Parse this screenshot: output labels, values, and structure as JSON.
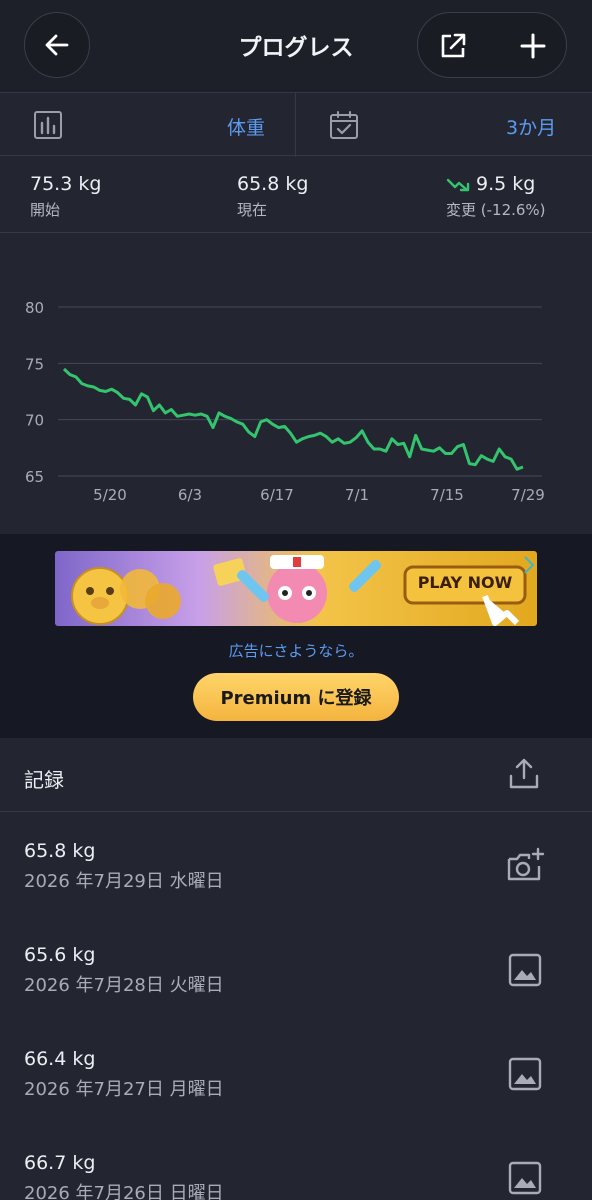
{
  "header": {
    "title": "プログレス",
    "back_icon": "arrow-left-icon",
    "share_icon": "external-link-icon",
    "add_icon": "plus-icon"
  },
  "selector": {
    "metric_icon": "bar-chart-icon",
    "metric_value": "体重",
    "range_icon": "calendar-check-icon",
    "range_value": "3か月"
  },
  "stats": {
    "start": {
      "value": "75.3 kg",
      "label": "開始"
    },
    "current": {
      "value": "65.8 kg",
      "label": "現在"
    },
    "change": {
      "value": "9.5 kg",
      "label": "変更 (-12.6%)",
      "trend_icon": "trend-down-icon",
      "trend_color": "#35c46e"
    }
  },
  "chart_data": {
    "type": "line",
    "x_tick_labels": [
      "5/20",
      "6/3",
      "6/17",
      "7/1",
      "7/15",
      "7/29"
    ],
    "y_ticks": [
      80,
      75,
      70,
      65
    ],
    "ylim": [
      65,
      80
    ],
    "grid": true,
    "line_color": "#35c46e",
    "series": [
      {
        "values": [
          74.5,
          74.0,
          73.8,
          73.2,
          73.0,
          72.9,
          72.6,
          72.5,
          72.7,
          72.4,
          71.9,
          71.8,
          71.3,
          72.3,
          72.0,
          70.8,
          71.3,
          70.6,
          70.9,
          70.3,
          70.4,
          70.5,
          70.4,
          70.5,
          70.3,
          69.3,
          70.6,
          70.3,
          70.1,
          69.8,
          69.6,
          68.9,
          68.5,
          69.8,
          70.0,
          69.6,
          69.3,
          69.4,
          68.8,
          68.0,
          68.3,
          68.5,
          68.6,
          68.8,
          68.5,
          68.0,
          68.3,
          67.9,
          68.0,
          68.4,
          69.0,
          68.0,
          67.4,
          67.4,
          67.2,
          68.3,
          67.8,
          67.9,
          66.7,
          68.6,
          67.4,
          67.3,
          67.2,
          67.5,
          67.0,
          67.0,
          67.6,
          67.8,
          66.1,
          66.0,
          66.8,
          66.5,
          66.3,
          67.4,
          66.7,
          66.5,
          65.6,
          65.8
        ]
      }
    ]
  },
  "ad": {
    "banner_text": "PLAY NOW",
    "goodbye_text": "広告にさようなら。",
    "premium_label": "Premium に登録"
  },
  "records": {
    "title": "記録",
    "export_icon": "share-upload-icon",
    "items": [
      {
        "weight": "65.8 kg",
        "date": "2026 年7月29日 水曜日",
        "icon": "camera-add-icon"
      },
      {
        "weight": "65.6 kg",
        "date": "2026 年7月28日 火曜日",
        "icon": "image-icon"
      },
      {
        "weight": "66.4 kg",
        "date": "2026 年7月27日 月曜日",
        "icon": "image-icon"
      },
      {
        "weight": "66.7 kg",
        "date": "2026 年7月26日 日曜日",
        "icon": "image-icon"
      }
    ]
  }
}
